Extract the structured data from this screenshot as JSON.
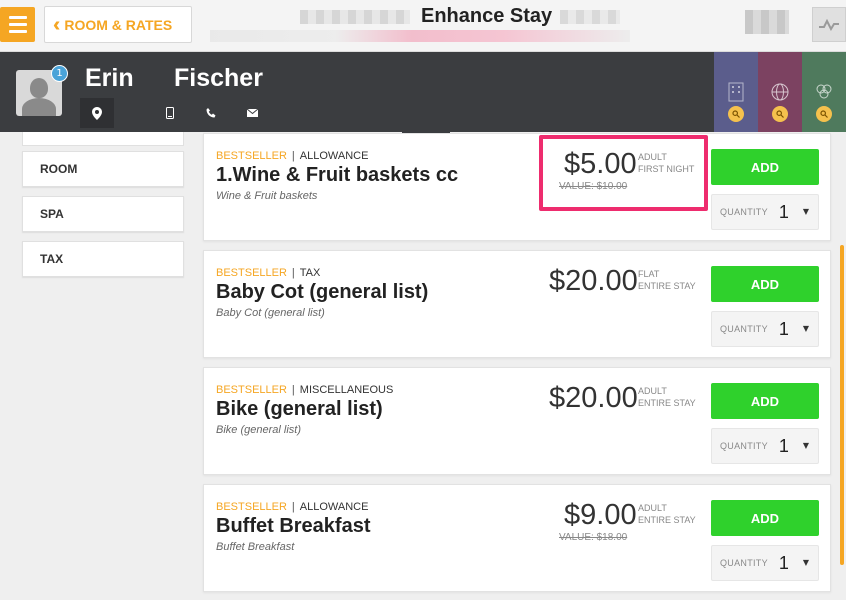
{
  "topbar": {
    "back_label": "ROOM & RATES",
    "title": "Enhance Stay"
  },
  "guest": {
    "first_name": "Erin",
    "last_name": "Fischer",
    "badge_count": "1"
  },
  "sidebar": {
    "items": [
      {
        "label": "ROOM"
      },
      {
        "label": "SPA"
      },
      {
        "label": "TAX"
      }
    ]
  },
  "cards": [
    {
      "tag": "BESTSELLER",
      "category": "ALLOWANCE",
      "title": "1.Wine & Fruit baskets cc",
      "subtitle": "Wine & Fruit baskets",
      "price": "$5.00",
      "unit_line1": "ADULT",
      "unit_line2": "FIRST NIGHT",
      "value": "VALUE: $10.00",
      "add_label": "ADD",
      "qty_label": "QUANTITY",
      "qty": "1"
    },
    {
      "tag": "BESTSELLER",
      "category": "TAX",
      "title": "Baby Cot (general list)",
      "subtitle": "Baby Cot (general list)",
      "price": "$20.00",
      "unit_line1": "FLAT",
      "unit_line2": "ENTIRE STAY",
      "add_label": "ADD",
      "qty_label": "QUANTITY",
      "qty": "1"
    },
    {
      "tag": "BESTSELLER",
      "category": "MISCELLANEOUS",
      "title": "Bike (general list)",
      "subtitle": "Bike (general list)",
      "price": "$20.00",
      "unit_line1": "ADULT",
      "unit_line2": "ENTIRE STAY",
      "add_label": "ADD",
      "qty_label": "QUANTITY",
      "qty": "1"
    },
    {
      "tag": "BESTSELLER",
      "category": "ALLOWANCE",
      "title": "Buffet Breakfast",
      "subtitle": "Buffet Breakfast",
      "price": "$9.00",
      "unit_line1": "ADULT",
      "unit_line2": "ENTIRE STAY",
      "value": "VALUE: $18.00",
      "add_label": "ADD",
      "qty_label": "QUANTITY",
      "qty": "1"
    }
  ],
  "colors": {
    "accent": "#f5a623",
    "add_button": "#2fd12c",
    "highlight": "#ee2c6e",
    "header_dark": "#3b3d40"
  },
  "icons": [
    "menu-icon",
    "chevrons-left-icon",
    "pulse-icon",
    "location-pin-icon",
    "mobile-phone-icon",
    "phone-icon",
    "mail-icon",
    "building-icon",
    "globe-icon",
    "nodes-icon",
    "search-icon"
  ]
}
